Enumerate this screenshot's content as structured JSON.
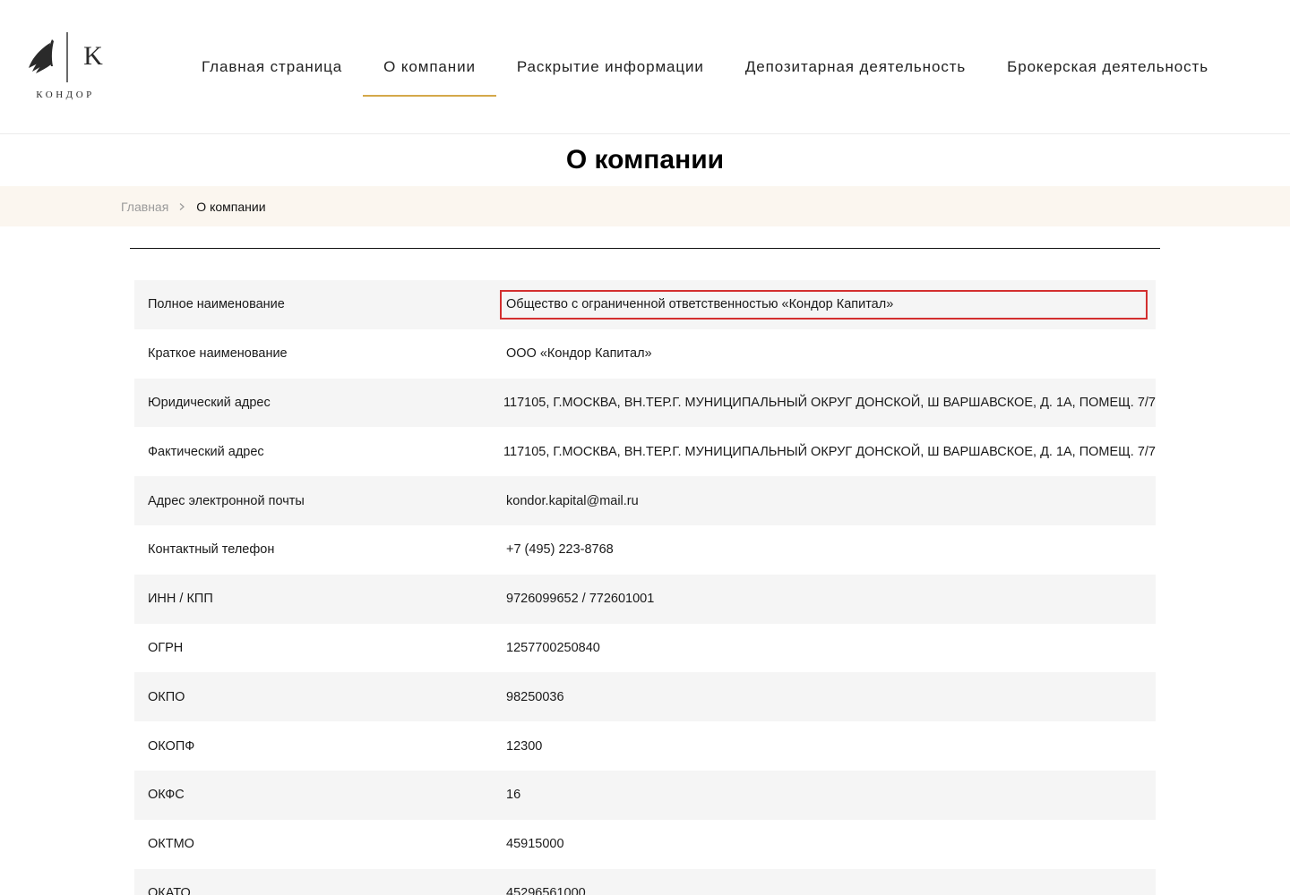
{
  "header": {
    "logo": {
      "letter": "K",
      "wordmark": "КОНДОР"
    },
    "nav": [
      {
        "label": "Главная страница",
        "active": false
      },
      {
        "label": "О компании",
        "active": true
      },
      {
        "label": "Раскрытие информации",
        "active": false
      },
      {
        "label": "Депозитарная деятельность",
        "active": false
      },
      {
        "label": "Брокерская деятельность",
        "active": false
      }
    ]
  },
  "page": {
    "title": "О компании"
  },
  "breadcrumb": {
    "home": "Главная",
    "current": "О компании"
  },
  "requisites": [
    {
      "label": "Полное наименование",
      "value": "Общество с ограниченной ответственностью «Кондор Капитал»"
    },
    {
      "label": "Краткое наименование",
      "value": "ООО «Кондор Капитал»"
    },
    {
      "label": "Юридический адрес",
      "value": "117105, Г.МОСКВА, ВН.ТЕР.Г. МУНИЦИПАЛЬНЫЙ ОКРУГ ДОНСКОЙ, Ш ВАРШАВСКОЕ, Д. 1А, ПОМЕЩ. 7/7"
    },
    {
      "label": "Фактический адрес",
      "value": "117105, Г.МОСКВА, ВН.ТЕР.Г. МУНИЦИПАЛЬНЫЙ ОКРУГ ДОНСКОЙ, Ш ВАРШАВСКОЕ, Д. 1А, ПОМЕЩ. 7/7"
    },
    {
      "label": "Адрес электронной почты",
      "value": "kondor.kapital@mail.ru"
    },
    {
      "label": "Контактный телефон",
      "value": "+7 (495) 223-8768"
    },
    {
      "label": "ИНН / КПП",
      "value": "9726099652 / 772601001"
    },
    {
      "label": "ОГРН",
      "value": "1257700250840"
    },
    {
      "label": "ОКПО",
      "value": "98250036"
    },
    {
      "label": "ОКОПФ",
      "value": "12300"
    },
    {
      "label": "ОКФС",
      "value": "16"
    },
    {
      "label": "ОКТМО",
      "value": "45915000"
    },
    {
      "label": "ОКАТО",
      "value": "45296561000"
    }
  ],
  "colors": {
    "accent": "#d4a84a",
    "breadcrumb_bg": "#fbf6ef",
    "row_alt": "#f5f5f5",
    "highlight": "#d32f2f"
  },
  "icons": {
    "logo": "condor-wing-logo",
    "breadcrumb_separator": "chevron-right-icon"
  }
}
